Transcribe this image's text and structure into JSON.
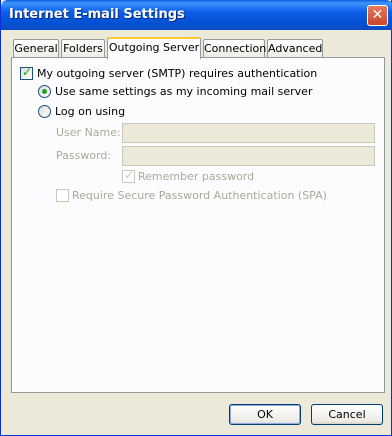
{
  "window": {
    "title": "Internet E-mail Settings",
    "close_glyph": "✕"
  },
  "tabs": [
    {
      "label": "General"
    },
    {
      "label": "Folders"
    },
    {
      "label": "Outgoing Server",
      "active": true
    },
    {
      "label": "Connection"
    },
    {
      "label": "Advanced"
    }
  ],
  "outgoing": {
    "requires_auth_label": "My outgoing server (SMTP) requires authentication",
    "requires_auth_checked": true,
    "same_settings_label": "Use same settings as my incoming mail server",
    "same_settings_selected": true,
    "log_on_label": "Log on using",
    "log_on_selected": false,
    "username_label": "User Name:",
    "username_value": "",
    "password_label": "Password:",
    "password_value": "",
    "remember_label": "Remember password",
    "remember_checked": true,
    "spa_label": "Require Secure Password Authentication (SPA)",
    "spa_checked": false
  },
  "buttons": {
    "ok": "OK",
    "cancel": "Cancel"
  },
  "colors": {
    "titlebar": "#0b5ee6",
    "face": "#ece9d8",
    "check": "#21a121",
    "active_tab_accent": "#ffc83c"
  },
  "icons": {
    "close": "close-icon",
    "check": "checkmark-icon",
    "radio": "radio-dot-icon"
  }
}
